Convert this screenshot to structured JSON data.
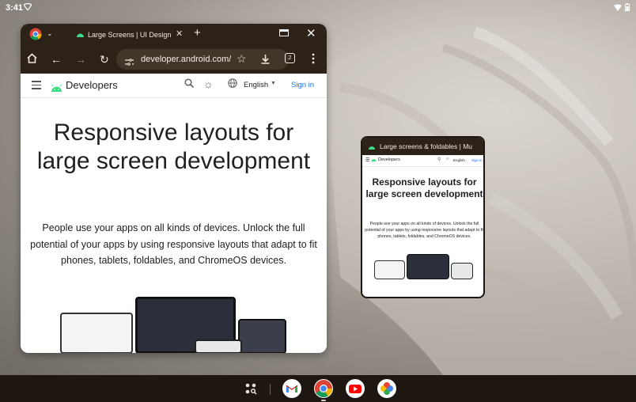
{
  "status_bar": {
    "time": "3:41"
  },
  "browser": {
    "tab_title": "Large Screens | UI Design",
    "url": "developer.android.com/",
    "tab_count": "2"
  },
  "site": {
    "name": "Developers",
    "language": "English",
    "sign_in": "Sign in",
    "hero_title": "Responsive layouts for large screen development",
    "hero_body": "People use your apps on all kinds of devices. Unlock the full potential of your apps by using responsive layouts that adapt to fit phones, tablets, foldables, and ChromeOS devices."
  },
  "pip": {
    "tab_title": "Large screens & foldables | Mu",
    "site_name": "Developers",
    "language": "English",
    "sign_in": "Sign in",
    "hero_title": "Responsive layouts for large screen development",
    "hero_body": "People use your apps on all kinds of devices. Unlock the full potential of your apps by using responsive layouts that adapt to fit phones, tablets, foldables, and ChromeOS devices."
  },
  "shelf": {
    "apps": [
      "gmail-icon",
      "chrome-icon",
      "youtube-icon",
      "photos-icon"
    ]
  },
  "colors": {
    "chrome_frame": "#2d2218",
    "link_blue": "#1a73e8",
    "android_green": "#3ddc84"
  }
}
